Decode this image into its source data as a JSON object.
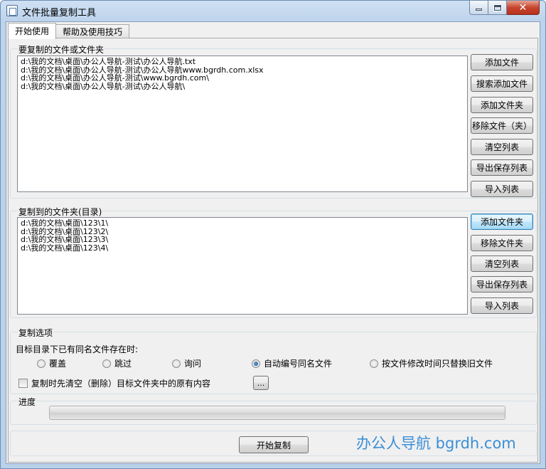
{
  "window": {
    "title": "文件批量复制工具"
  },
  "tabs": [
    {
      "label": "开始使用",
      "active": true
    },
    {
      "label": "帮助及使用技巧",
      "active": false
    }
  ],
  "source_group": {
    "label": "要复制的文件或文件夹",
    "items": [
      "d:\\我的文档\\桌面\\办公人导航-测试\\办公人导航.txt",
      "d:\\我的文档\\桌面\\办公人导航-测试\\办公人导航www.bgrdh.com.xlsx",
      "d:\\我的文档\\桌面\\办公人导航-测试\\www.bgrdh.com\\",
      "d:\\我的文档\\桌面\\办公人导航-测试\\办公人导航\\"
    ],
    "buttons": [
      "添加文件",
      "搜索添加文件",
      "添加文件夹",
      "移除文件（夹）",
      "清空列表",
      "导出保存列表",
      "导入列表"
    ]
  },
  "dest_group": {
    "label": "复制到的文件夹(目录)",
    "items": [
      "d:\\我的文档\\桌面\\123\\1\\",
      "d:\\我的文档\\桌面\\123\\2\\",
      "d:\\我的文档\\桌面\\123\\3\\",
      "d:\\我的文档\\桌面\\123\\4\\"
    ],
    "buttons": [
      "添加文件夹",
      "移除文件夹",
      "清空列表",
      "导出保存列表",
      "导入列表"
    ]
  },
  "options": {
    "label": "复制选项",
    "conflict_label": "目标目录下已有同名文件存在时:",
    "radios": [
      {
        "label": "覆盖",
        "checked": false
      },
      {
        "label": "跳过",
        "checked": false
      },
      {
        "label": "询问",
        "checked": false
      },
      {
        "label": "自动编号同名文件",
        "checked": true
      },
      {
        "label": "按文件修改时间只替换旧文件",
        "checked": false
      }
    ],
    "clear_checkbox": {
      "label": "复制时先清空（删除）目标文件夹中的原有内容",
      "checked": false
    },
    "more_button": "..."
  },
  "progress": {
    "label": "进度",
    "value": 0
  },
  "start_button": "开始复制",
  "watermark": "办公人导航 bgrdh.com"
}
